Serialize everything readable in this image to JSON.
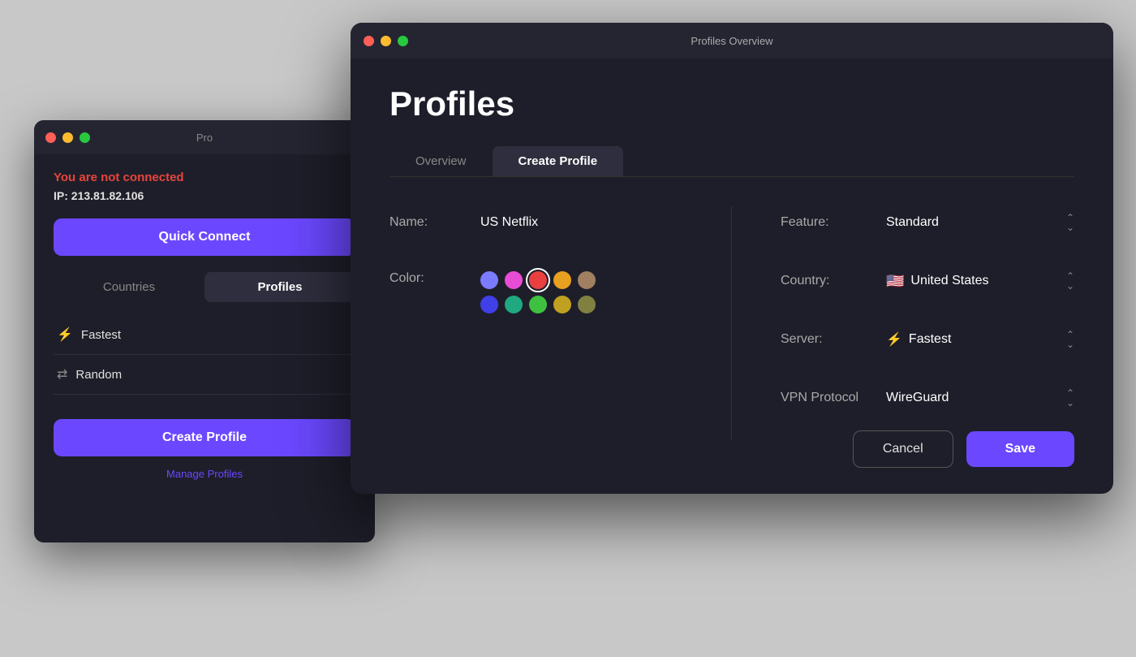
{
  "bg_window": {
    "title": "Pro",
    "status": "You are not connected",
    "ip_label": "IP:",
    "ip_value": "213.81.82.106",
    "quick_connect": "Quick Connect",
    "tab_countries": "Countries",
    "tab_profiles": "Profiles",
    "profiles": [
      {
        "icon": "⚡",
        "name": "Fastest"
      },
      {
        "icon": "⇄",
        "name": "Random"
      }
    ],
    "create_profile": "Create Profile",
    "manage_profiles": "Manage Profiles"
  },
  "fg_window": {
    "title": "Profiles Overview",
    "page_title": "Profiles",
    "tab_overview": "Overview",
    "tab_create": "Create Profile",
    "form": {
      "name_label": "Name:",
      "name_value": "US Netflix",
      "color_label": "Color:",
      "colors": [
        {
          "hex": "#7b7bff",
          "selected": false
        },
        {
          "hex": "#e84cd5",
          "selected": false
        },
        {
          "hex": "#e84040",
          "selected": true
        },
        {
          "hex": "#e8a020",
          "selected": false
        },
        {
          "hex": "#a08060",
          "selected": false
        },
        {
          "hex": "#4040e8",
          "selected": false
        },
        {
          "hex": "#20a880",
          "selected": false
        },
        {
          "hex": "#40c040",
          "selected": false
        },
        {
          "hex": "#c0a020",
          "selected": false
        },
        {
          "hex": "#808040",
          "selected": false
        }
      ],
      "feature_label": "Feature:",
      "feature_value": "Standard",
      "country_label": "Country:",
      "country_flag": "🇺🇸",
      "country_value": "United States",
      "server_label": "Server:",
      "server_value": "Fastest",
      "vpn_protocol_label": "VPN Protocol",
      "vpn_protocol_value": "WireGuard"
    },
    "cancel_label": "Cancel",
    "save_label": "Save"
  }
}
